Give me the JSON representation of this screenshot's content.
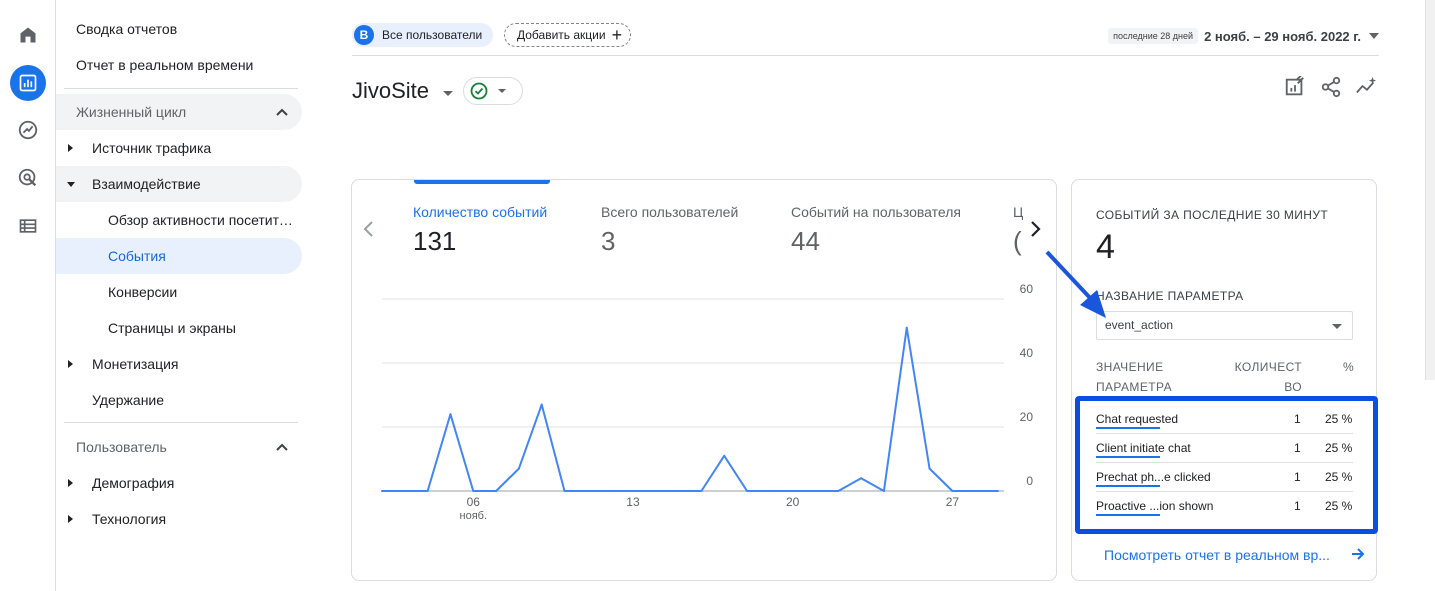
{
  "rail": {
    "icons": [
      "home-icon",
      "reports-icon",
      "explore-icon",
      "advertising-icon",
      "configure-icon"
    ],
    "accent": "#1a73e8"
  },
  "nav": {
    "summary": "Сводка отчетов",
    "realtime": "Отчет в реальном времени",
    "lifecycle": "Жизненный цикл",
    "acquisition": "Источник трафика",
    "engagement": "Взаимодействие",
    "engagement_overview": "Обзор активности посетителей",
    "events": "События",
    "conversions": "Конверсии",
    "pages": "Страницы и экраны",
    "monetization": "Монетизация",
    "retention": "Удержание",
    "user": "Пользователь",
    "demographics": "Демография",
    "tech": "Технология"
  },
  "header": {
    "segment_badge": "B",
    "segment_label": "Все пользователи",
    "add_comparison": "Добавить акции",
    "date_prefix": "последние 28 дней",
    "date_range": "2 нояб. – 29 нояб. 2022 г."
  },
  "title": {
    "text": "JivoSite"
  },
  "metrics": [
    {
      "label": "Количество событий",
      "value": "131"
    },
    {
      "label": "Всего пользователей",
      "value": "3"
    },
    {
      "label": "Событий на пользователя",
      "value": "44"
    },
    {
      "label": "Ц",
      "value": "("
    }
  ],
  "chart_data": {
    "type": "line",
    "x": [
      "02",
      "03",
      "04",
      "05",
      "06",
      "07",
      "08",
      "09",
      "10",
      "11",
      "12",
      "13",
      "14",
      "15",
      "16",
      "17",
      "18",
      "19",
      "20",
      "21",
      "22",
      "23",
      "24",
      "25",
      "26",
      "27",
      "28",
      "29"
    ],
    "series": [
      {
        "values": [
          0,
          0,
          0,
          24,
          0,
          0,
          7,
          27,
          0,
          0,
          0,
          0,
          0,
          0,
          0,
          11,
          0,
          0,
          0,
          0,
          0,
          4,
          0,
          51,
          7,
          0,
          0,
          0
        ]
      }
    ],
    "x_tick_labels": [
      "06",
      "13",
      "20",
      "27"
    ],
    "x_tick_sublabel": "нояб.",
    "y_ticks": [
      0,
      20,
      40,
      60
    ],
    "ylim": [
      0,
      60
    ],
    "grid": true,
    "color": "#4285f4"
  },
  "side": {
    "header": "СОБЫТИЙ ЗА ПОСЛЕДНИЕ 30 МИНУТ",
    "count": "4",
    "param_header": "НАЗВАНИЕ ПАРАМЕТРА",
    "param_value": "event_action",
    "col_value_1": "ЗНАЧЕНИЕ",
    "col_value_2": "ПАРАМЕТРА",
    "col_count_1": "КОЛИЧЕСТ",
    "col_count_2": "ВО",
    "col_pct": "%",
    "rows": [
      {
        "name": "Chat requested",
        "count": "1",
        "pct": "25 %"
      },
      {
        "name": "Client initiate chat",
        "count": "1",
        "pct": "25 %"
      },
      {
        "name": "Prechat ph...e clicked",
        "count": "1",
        "pct": "25 %"
      },
      {
        "name": "Proactive ...ion shown",
        "count": "1",
        "pct": "25 %"
      }
    ],
    "link": "Посмотреть отчет в реальном вр..."
  }
}
